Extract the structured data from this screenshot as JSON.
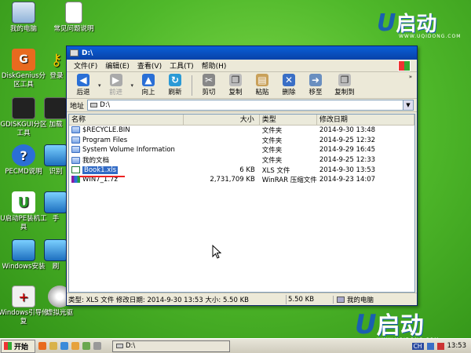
{
  "desktop": {
    "icons": [
      {
        "label": "我的电脑",
        "glyph": ""
      },
      {
        "label": "常见问题说明",
        "glyph": ""
      },
      {
        "label": "DiskGenius分区工具",
        "glyph": "G"
      },
      {
        "label": "登录",
        "glyph": "⚷"
      },
      {
        "label": "GDISKGUI分区工具",
        "glyph": ""
      },
      {
        "label": "加载",
        "glyph": ""
      },
      {
        "label": "PECMD说明",
        "glyph": "?"
      },
      {
        "label": "识别",
        "glyph": ""
      },
      {
        "label": "U启动PE装机工具",
        "glyph": "U"
      },
      {
        "label": "手",
        "glyph": ""
      },
      {
        "label": "Windows安装",
        "glyph": ""
      },
      {
        "label": "刷",
        "glyph": ""
      },
      {
        "label": "Windows引导修复",
        "glyph": "+"
      },
      {
        "label": "虚拟光驱",
        "glyph": ""
      }
    ]
  },
  "logo": {
    "mark": "U",
    "name": "启动",
    "url": "WWW.UQIDONG.COM"
  },
  "window": {
    "title": "D:\\",
    "menu": [
      "文件(F)",
      "编辑(E)",
      "查看(V)",
      "工具(T)",
      "帮助(H)"
    ],
    "toolbar": {
      "back": "后退",
      "forward": "前进",
      "up": "向上",
      "refresh": "刷新",
      "cut": "剪切",
      "copy": "复制",
      "paste": "粘贴",
      "delete": "删除",
      "move": "移至",
      "copyto": "复制到"
    },
    "address": {
      "label": "地址",
      "value": "D:\\"
    },
    "columns": {
      "name": "名称",
      "size": "大小",
      "type": "类型",
      "date": "修改日期"
    },
    "files": [
      {
        "name": "$RECYCLE.BIN",
        "size": "",
        "type": "文件夹",
        "date": "2014-9-30 13:48",
        "kind": "folder"
      },
      {
        "name": "Program Files",
        "size": "",
        "type": "文件夹",
        "date": "2014-9-25 12:32",
        "kind": "folder"
      },
      {
        "name": "System Volume Information",
        "size": "",
        "type": "文件夹",
        "date": "2014-9-29 16:45",
        "kind": "folder"
      },
      {
        "name": "我的文档",
        "size": "",
        "type": "文件夹",
        "date": "2014-9-25 12:33",
        "kind": "folder"
      },
      {
        "name": "Book1.xls",
        "size": "6 KB",
        "type": "XLS 文件",
        "date": "2014-9-30 13:53",
        "kind": "xls"
      },
      {
        "name": "WIN7_1.7z",
        "size": "2,731,709 KB",
        "type": "WinRAR 压缩文件",
        "date": "2014-9-23 14:07",
        "kind": "rar"
      }
    ],
    "status": {
      "info": "类型: XLS 文件 修改日期: 2014-9-30 13:53 大小: 5.50 KB",
      "size": "5.50 KB",
      "location": "我的电脑"
    }
  },
  "taskbar": {
    "start": "开始",
    "task": "D:\\",
    "lang": "CH",
    "time": "13:53"
  }
}
